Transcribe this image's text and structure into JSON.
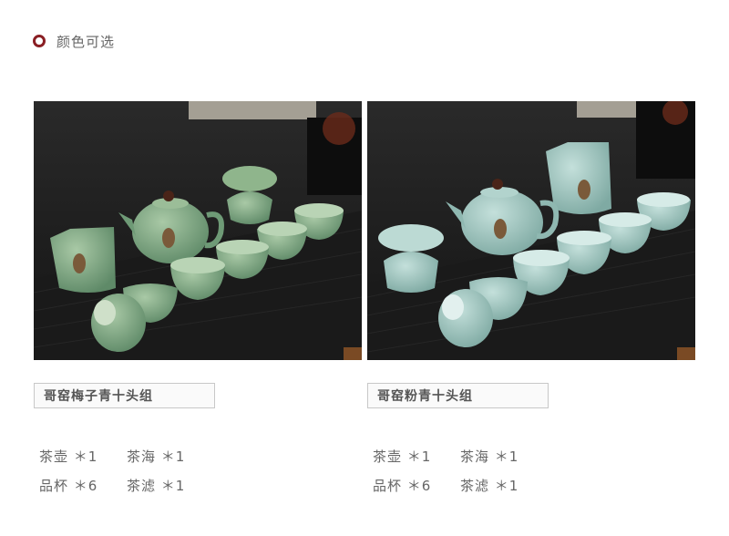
{
  "section": {
    "title": "颜色可选"
  },
  "products": [
    {
      "name": "哥窑梅子青十头组",
      "glaze_color": "#7fa88a",
      "items": [
        [
          "茶壶 ＊1",
          "茶海 ＊1"
        ],
        [
          "品杯 ＊6",
          "茶滤 ＊1"
        ]
      ]
    },
    {
      "name": "哥窑粉青十头组",
      "glaze_color": "#9cc3bd",
      "items": [
        [
          "茶壶 ＊1",
          "茶海 ＊1"
        ],
        [
          "品杯 ＊6",
          "茶滤 ＊1"
        ]
      ]
    }
  ]
}
